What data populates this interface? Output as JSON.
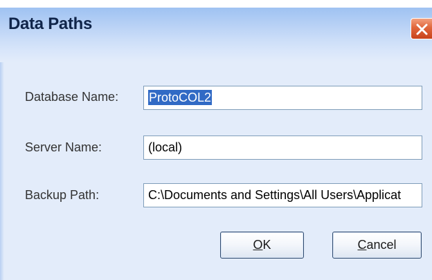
{
  "window": {
    "title": "Data Paths"
  },
  "form": {
    "database_name_label": "Database Name:",
    "database_name_value": "ProtoCOL2",
    "server_name_label": "Server Name:",
    "server_name_value": "(local)",
    "backup_path_label": "Backup Path:",
    "backup_path_value": "C:\\Documents and Settings\\All Users\\Applicat"
  },
  "buttons": {
    "ok_access_key": "O",
    "ok_rest": "K",
    "cancel_access_key": "C",
    "cancel_rest": "ancel"
  },
  "icons": {
    "close": "close-icon"
  },
  "colors": {
    "close_button": "#e0663b",
    "selection": "#316ac5",
    "dialog_background": "#e3ecfa"
  }
}
